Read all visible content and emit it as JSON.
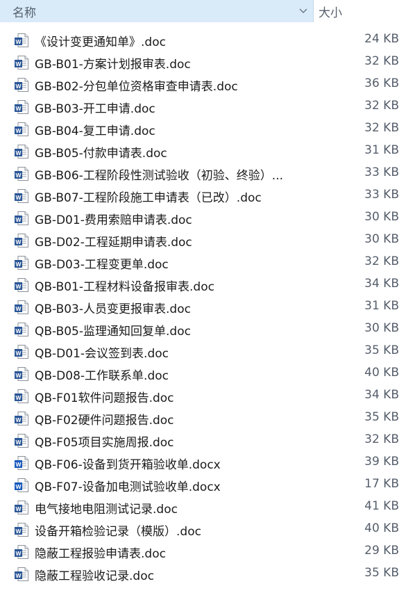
{
  "header": {
    "name_label": "名称",
    "size_label": "大小",
    "sort_icon": "chevron-down-icon"
  },
  "files": [
    {
      "name": "《设计变更通知单》.doc",
      "size": "24 KB",
      "icon": "word-doc-icon"
    },
    {
      "name": "GB-B01-方案计划报审表.doc",
      "size": "32 KB",
      "icon": "word-doc-icon"
    },
    {
      "name": "GB-B02-分包单位资格审查申请表.doc",
      "size": "36 KB",
      "icon": "word-doc-icon"
    },
    {
      "name": "GB-B03-开工申请.doc",
      "size": "32 KB",
      "icon": "word-doc-icon"
    },
    {
      "name": "GB-B04-复工申请.doc",
      "size": "32 KB",
      "icon": "word-doc-icon"
    },
    {
      "name": "GB-B05-付款申请表.doc",
      "size": "31 KB",
      "icon": "word-doc-icon"
    },
    {
      "name": "GB-B06-工程阶段性测试验收（初验、终验）...",
      "size": "33 KB",
      "icon": "word-doc-icon"
    },
    {
      "name": "GB-B07-工程阶段施工申请表（已改）.doc",
      "size": "33 KB",
      "icon": "word-doc-icon"
    },
    {
      "name": "GB-D01-费用索赔申请表.doc",
      "size": "30 KB",
      "icon": "word-doc-icon"
    },
    {
      "name": "GB-D02-工程延期申请表.doc",
      "size": "30 KB",
      "icon": "word-doc-icon"
    },
    {
      "name": "GB-D03-工程变更单.doc",
      "size": "32 KB",
      "icon": "word-doc-icon"
    },
    {
      "name": "QB-B01-工程材料设备报审表.doc",
      "size": "34 KB",
      "icon": "word-doc-icon"
    },
    {
      "name": "QB-B03-人员变更报审表.doc",
      "size": "31 KB",
      "icon": "word-doc-icon"
    },
    {
      "name": "QB-B05-监理通知回复单.doc",
      "size": "30 KB",
      "icon": "word-doc-icon"
    },
    {
      "name": "QB-D01-会议签到表.doc",
      "size": "35 KB",
      "icon": "word-doc-icon"
    },
    {
      "name": "QB-D08-工作联系单.doc",
      "size": "40 KB",
      "icon": "word-doc-icon"
    },
    {
      "name": "QB-F01软件问题报告.doc",
      "size": "34 KB",
      "icon": "word-doc-icon"
    },
    {
      "name": "QB-F02硬件问题报告.doc",
      "size": "35 KB",
      "icon": "word-doc-icon"
    },
    {
      "name": "QB-F05项目实施周报.doc",
      "size": "32 KB",
      "icon": "word-doc-icon"
    },
    {
      "name": "QB-F06-设备到货开箱验收单.docx",
      "size": "39 KB",
      "icon": "word-docx-icon"
    },
    {
      "name": "QB-F07-设备加电测试验收单.docx",
      "size": "17 KB",
      "icon": "word-docx-icon"
    },
    {
      "name": "电气接地电阻测试记录.doc",
      "size": "41 KB",
      "icon": "word-doc-icon"
    },
    {
      "name": "设备开箱检验记录（模版）.doc",
      "size": "40 KB",
      "icon": "word-doc-icon"
    },
    {
      "name": "隐蔽工程报验申请表.doc",
      "size": "29 KB",
      "icon": "word-doc-icon"
    },
    {
      "name": "隐蔽工程验收记录.doc",
      "size": "35 KB",
      "icon": "word-doc-icon"
    }
  ]
}
